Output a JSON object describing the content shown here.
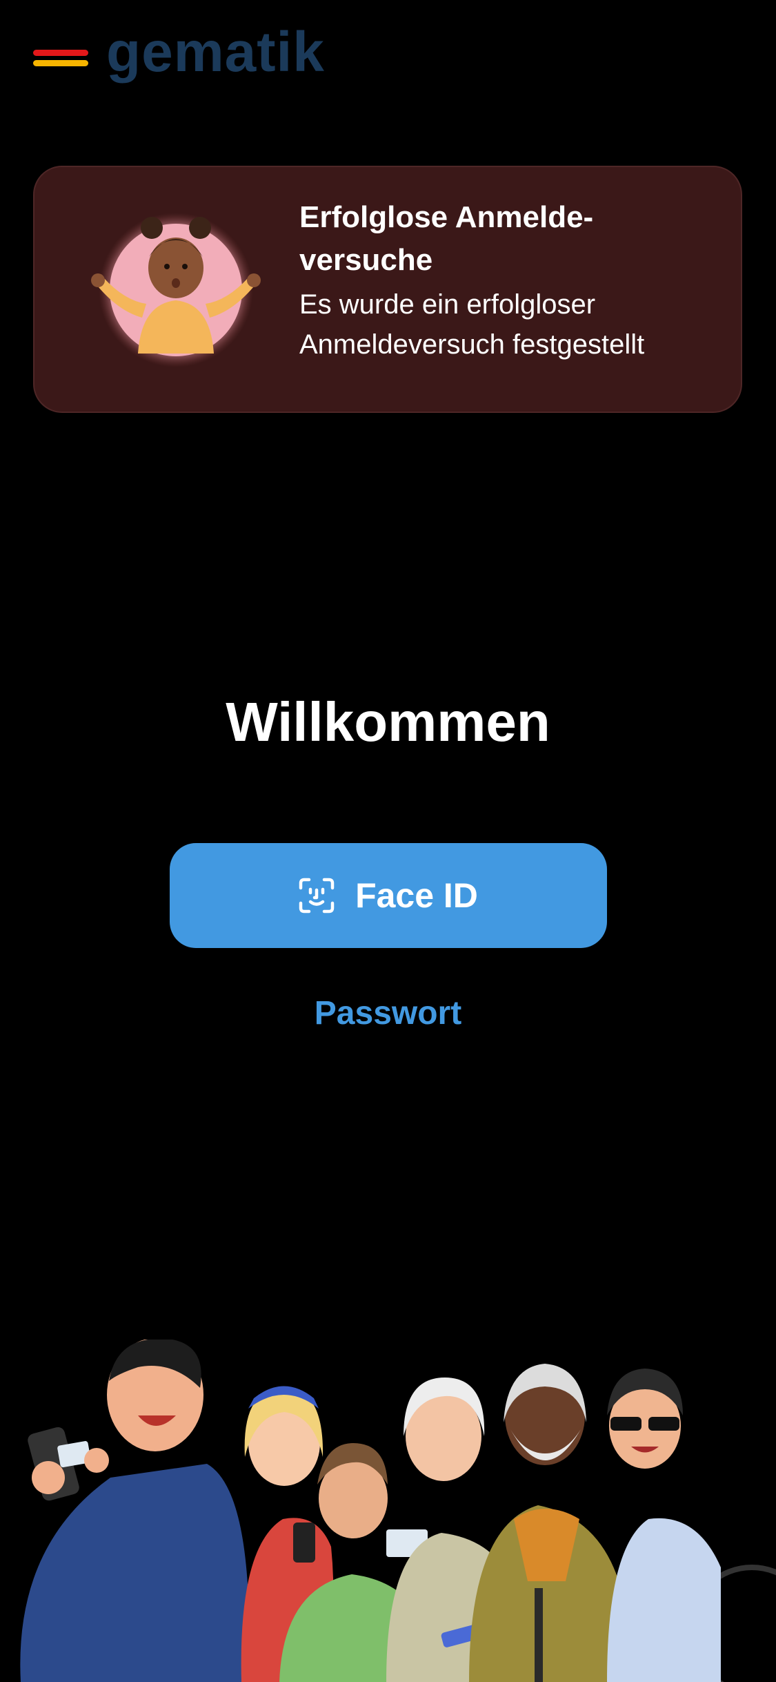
{
  "header": {
    "logo_text": "gematik",
    "logo_icon": "gematik-logo-icon",
    "colors": {
      "red": "#e3181a",
      "yellow": "#f7b500",
      "text": "#1b3a5a"
    }
  },
  "alert": {
    "title": "Erfolglose Anmelde-versuche",
    "title_line1": "Erfolglose Anmelde-",
    "title_line2": "versuche",
    "text_line1": "Es wurde ein erfolgloser",
    "text_line2": "Anmeldeversuch festgestellt",
    "illustration": "confused-person-illustration",
    "background_color": "#3b1818"
  },
  "main": {
    "welcome": "Willkommen",
    "faceid_label": "Face ID",
    "faceid_icon": "face-id-icon",
    "password_label": "Passwort",
    "accent_color": "#4299e1"
  },
  "footer": {
    "illustration": "people-group-illustration"
  }
}
